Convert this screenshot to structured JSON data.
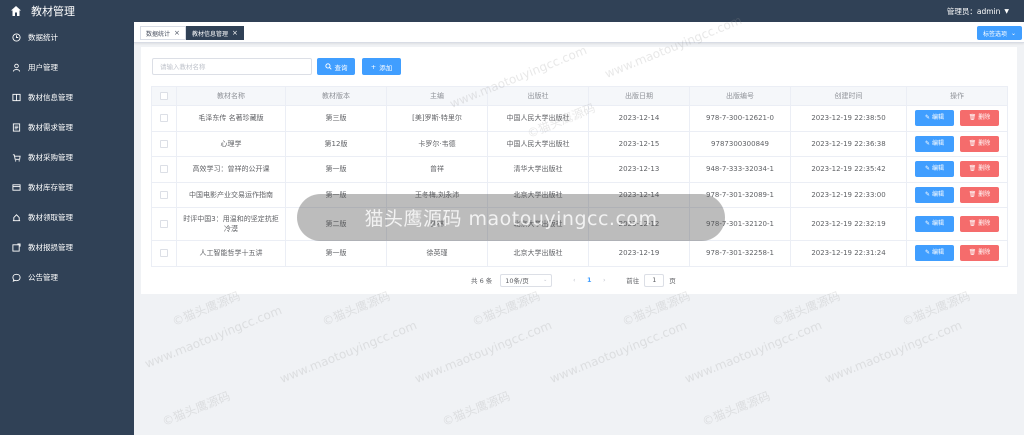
{
  "header": {
    "app_title": "教材管理",
    "user_label": "管理员：admin"
  },
  "sidebar": {
    "items": [
      {
        "label": "数据统计",
        "icon": "clock-icon"
      },
      {
        "label": "用户管理",
        "icon": "user-icon"
      },
      {
        "label": "教材信息管理",
        "icon": "book-icon"
      },
      {
        "label": "教材需求管理",
        "icon": "document-icon"
      },
      {
        "label": "教材采购管理",
        "icon": "cart-icon"
      },
      {
        "label": "教材库存管理",
        "icon": "inventory-icon"
      },
      {
        "label": "教材领取管理",
        "icon": "receive-icon"
      },
      {
        "label": "教材报损管理",
        "icon": "report-icon"
      },
      {
        "label": "公告管理",
        "icon": "chat-icon"
      }
    ]
  },
  "tags": [
    {
      "label": "数据统计",
      "active": false
    },
    {
      "label": "教材信息管理",
      "active": true
    }
  ],
  "tab_options_label": "标签选项",
  "search": {
    "placeholder": "请输入教材名称",
    "query_label": "查询",
    "add_label": "添加"
  },
  "table": {
    "headers": [
      "教材名称",
      "教材版本",
      "主编",
      "出版社",
      "出版日期",
      "出版编号",
      "创建时间",
      "操作"
    ],
    "rows": [
      {
        "name": "毛泽东传 名著珍藏版",
        "version": "第三版",
        "editor": "[美]罗斯·特里尔",
        "publisher": "中国人民大学出版社",
        "date": "2023-12-14",
        "isbn": "978-7-300-12621-0",
        "created": "2023-12-19 22:38:50"
      },
      {
        "name": "心理学",
        "version": "第12版",
        "editor": "卡罗尔·韦德",
        "publisher": "中国人民大学出版社",
        "date": "2023-12-15",
        "isbn": "9787300300849",
        "created": "2023-12-19 22:36:38"
      },
      {
        "name": "高效学习：曾祥的公开课",
        "version": "第一版",
        "editor": "曾祥",
        "publisher": "清华大学出版社",
        "date": "2023-12-13",
        "isbn": "948-7-333-32034-1",
        "created": "2023-12-19 22:35:42"
      },
      {
        "name": "中国电影产业交易运作指南",
        "version": "第一版",
        "editor": "王冬梅,刘永沛",
        "publisher": "北京大学出版社",
        "date": "2023-12-14",
        "isbn": "978-7-301-32089-1",
        "created": "2023-12-19 22:33:00"
      },
      {
        "name": "时评中国3：用温和的坚定抗拒冷漠",
        "version": "第二版",
        "editor": "曹林",
        "publisher": "北京大学出版社",
        "date": "2023-12-12",
        "isbn": "978-7-301-32120-1",
        "created": "2023-12-19 22:32:19"
      },
      {
        "name": "人工智能哲学十五讲",
        "version": "第一版",
        "editor": "徐英瑾",
        "publisher": "北京大学出版社",
        "date": "2023-12-19",
        "isbn": "978-7-301-32258-1",
        "created": "2023-12-19 22:31:24"
      }
    ],
    "edit_label": "编辑",
    "delete_label": "删除"
  },
  "pagination": {
    "total": "共 6 条",
    "page_size": "10条/页",
    "current_page": "1",
    "goto_label": "前往",
    "goto_value": "1",
    "page_unit": "页"
  },
  "watermark": {
    "text_cn": "©猫头鹰源码",
    "text_url": "www.maotouyingcc.com",
    "overlay_text": "猫头鹰源码 maotouyingcc.com"
  },
  "colors": {
    "sidebar_bg": "#304156",
    "primary": "#409eff",
    "danger": "#f56c6c"
  }
}
